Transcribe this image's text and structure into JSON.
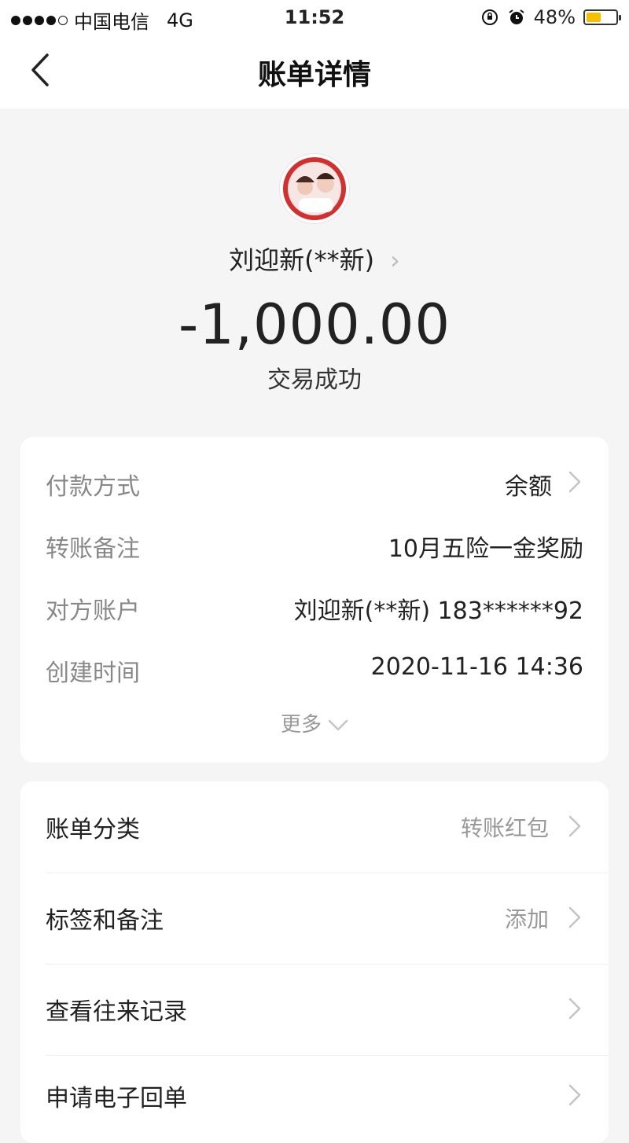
{
  "status_bar": {
    "carrier": "中国电信",
    "network": "4G",
    "time": "11:52",
    "battery": "48%"
  },
  "nav": {
    "title": "账单详情"
  },
  "header": {
    "payee": "刘迎新(**新)",
    "amount": "-1,000.00",
    "status": "交易成功"
  },
  "details": [
    {
      "label": "付款方式",
      "value": "余额"
    },
    {
      "label": "转账备注",
      "value": "10月五险一金奖励"
    },
    {
      "label": "对方账户",
      "value": "刘迎新(**新) 183******92"
    },
    {
      "label": "创建时间",
      "value": "2020-11-16 14:36"
    }
  ],
  "more_label": "更多",
  "menu": [
    {
      "label": "账单分类",
      "value": "转账红包"
    },
    {
      "label": "标签和备注",
      "value": "添加"
    },
    {
      "label": "查看往来记录",
      "value": ""
    },
    {
      "label": "申请电子回单",
      "value": ""
    }
  ],
  "colors": {
    "background": "#f5f5f5",
    "battery_fill": "#f5c000",
    "muted_text": "#888888"
  }
}
